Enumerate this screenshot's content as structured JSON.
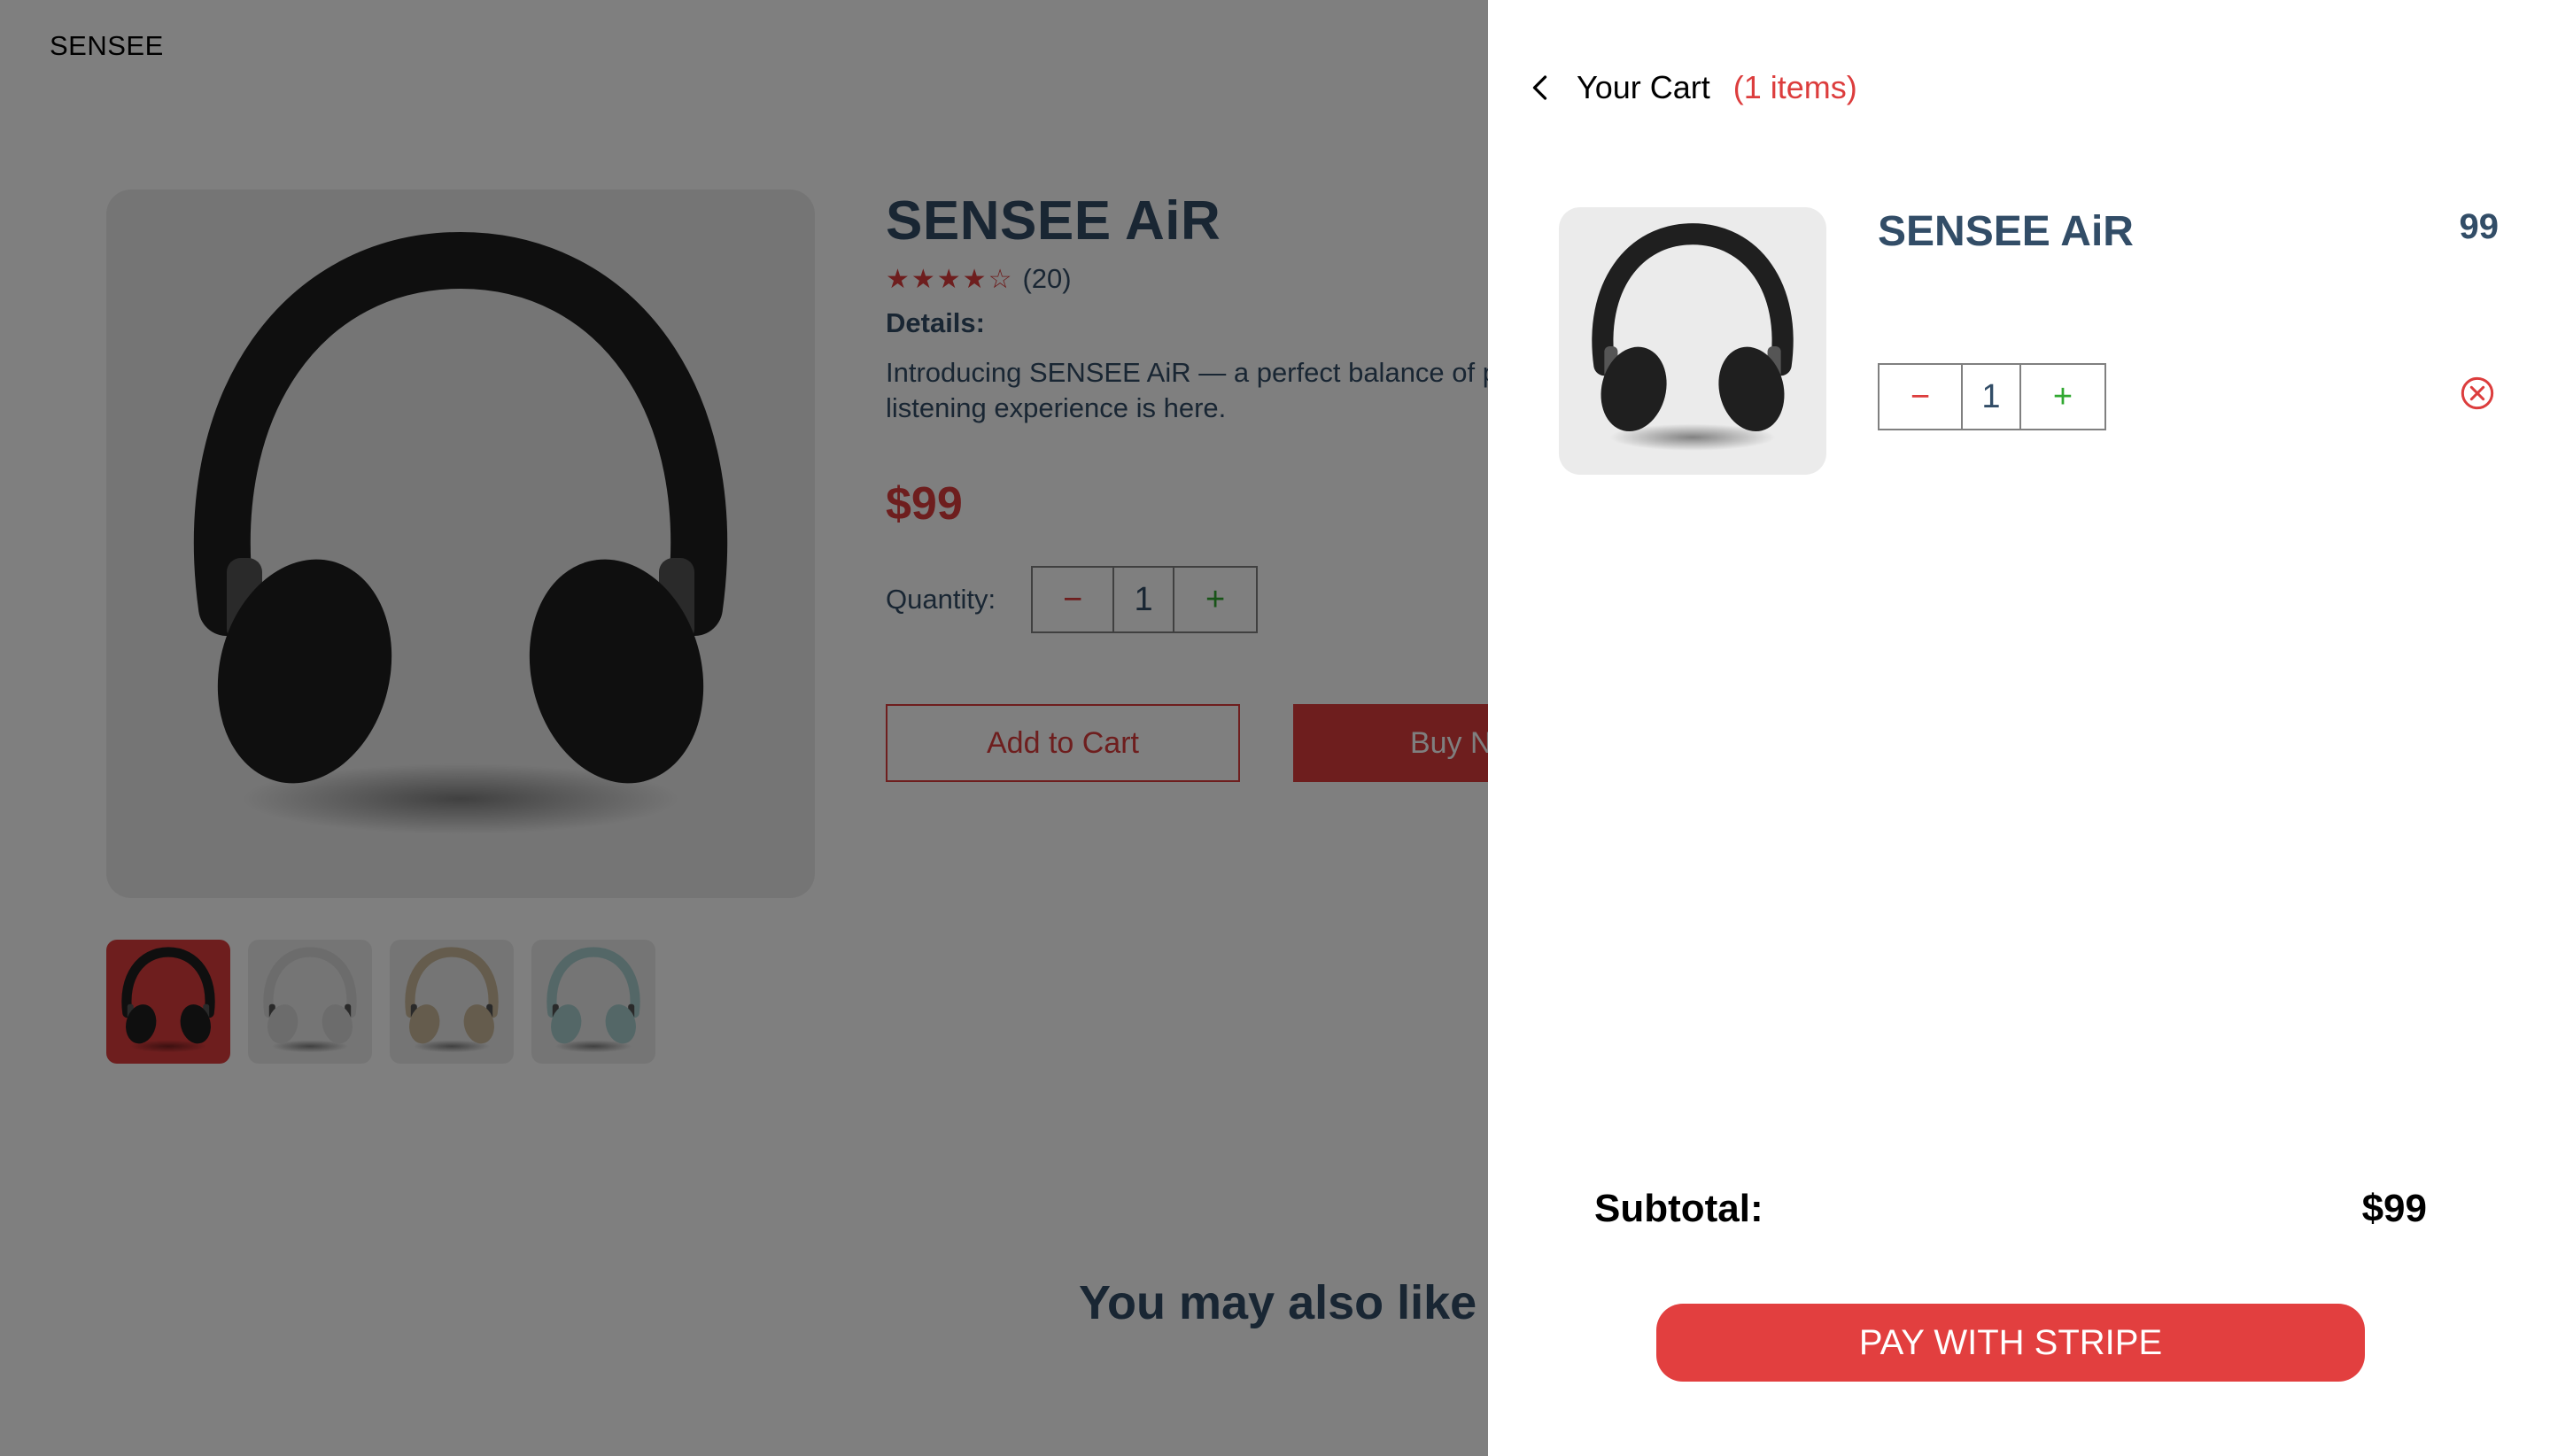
{
  "brand": "SENSEE",
  "product": {
    "name": "SENSEE AiR",
    "stars": "★★★★☆",
    "review_count": "(20)",
    "details_heading": "Details:",
    "description": "Introducing SENSEE AiR — a perfect balance of personal listening experience is here.",
    "price": "$99",
    "quantity_label": "Quantity:",
    "quantity": "1",
    "minus_symbol": "−",
    "plus_symbol": "+",
    "add_to_cart_label": "Add to Cart",
    "buy_now_label": "Buy Now"
  },
  "also_like_heading": "You may also like",
  "thumbnails": [
    {
      "color": "black",
      "bg": "#dc3d3d",
      "selected": true
    },
    {
      "color": "white",
      "bg": "#ebebeb",
      "selected": false
    },
    {
      "color": "beige",
      "bg": "#ebebeb",
      "selected": false
    },
    {
      "color": "mint",
      "bg": "#ebebeb",
      "selected": false
    }
  ],
  "cart": {
    "heading": "Your Cart",
    "count_label": "(1 items)",
    "items": [
      {
        "name": "SENSEE AiR",
        "price": "99",
        "quantity": "1"
      }
    ],
    "minus_symbol": "−",
    "plus_symbol": "+",
    "subtotal_label": "Subtotal:",
    "subtotal_value": "$99",
    "pay_label": "PAY WITH STRIPE"
  },
  "colors": {
    "accent": "#dc3d3d",
    "heading": "#324d67",
    "plus_green": "#31a831",
    "overlay": "rgba(0,0,0,0.5)"
  },
  "icons": {
    "back": "chevron-left-icon",
    "remove": "remove-circle-icon"
  }
}
